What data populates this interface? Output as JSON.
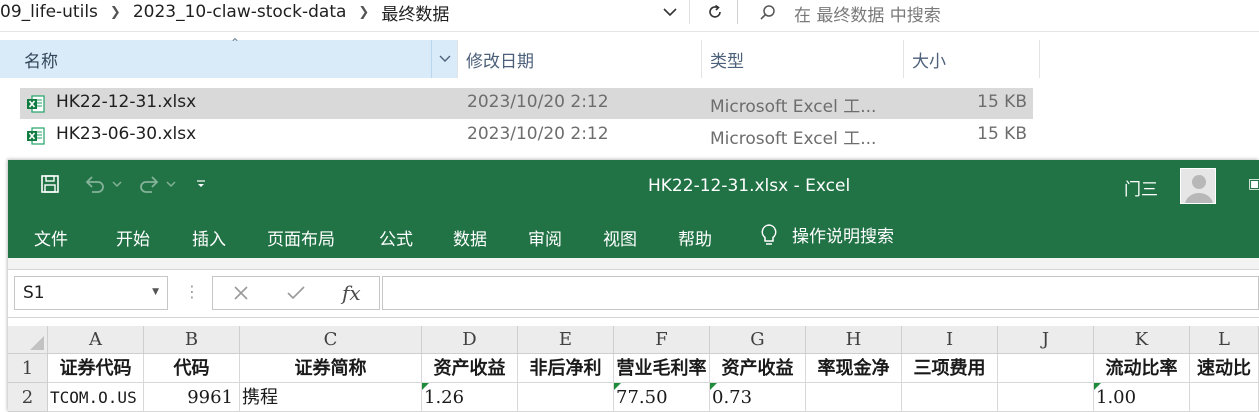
{
  "explorer": {
    "breadcrumb": [
      "09_life-utils",
      "2023_10-claw-stock-data",
      "最终数据"
    ],
    "search_placeholder": "在 最终数据 中搜索",
    "columns": {
      "name": "名称",
      "date": "修改日期",
      "type": "类型",
      "size": "大小"
    },
    "files": [
      {
        "name": "HK22-12-31.xlsx",
        "date": "2023/10/20 2:12",
        "type": "Microsoft Excel 工...",
        "size": "15 KB",
        "selected": true
      },
      {
        "name": "HK23-06-30.xlsx",
        "date": "2023/10/20 2:12",
        "type": "Microsoft Excel 工...",
        "size": "15 KB",
        "selected": false
      }
    ]
  },
  "excel": {
    "title": "HK22-12-31.xlsx  -  Excel",
    "user": "门三",
    "tabs": [
      "文件",
      "开始",
      "插入",
      "页面布局",
      "公式",
      "数据",
      "审阅",
      "视图",
      "帮助"
    ],
    "tell_me": "操作说明搜索",
    "name_box": "S1",
    "formula": "",
    "fx_label": "fx",
    "column_letters": [
      "A",
      "B",
      "C",
      "D",
      "E",
      "F",
      "G",
      "H",
      "I",
      "J",
      "K",
      "L"
    ],
    "row_numbers": [
      "1",
      "2"
    ],
    "header_row": [
      "证券代码",
      "代码",
      "证券简称",
      "资产收益",
      "非后净利",
      "营业毛利率",
      "资产收益",
      "率现金净",
      "三项费用",
      "",
      "流动比率",
      "速动比"
    ],
    "data_row": [
      "TCOM.O.US",
      "9961",
      "携程",
      "1.26",
      "",
      "77.50",
      "0.73",
      "",
      "",
      "",
      "1.00",
      ""
    ]
  },
  "colors": {
    "excel_green": "#217346",
    "explorer_header_selected": "#d9ebf9",
    "row_selected": "#d9d9d9",
    "error_indicator": "#1e8c3a"
  }
}
